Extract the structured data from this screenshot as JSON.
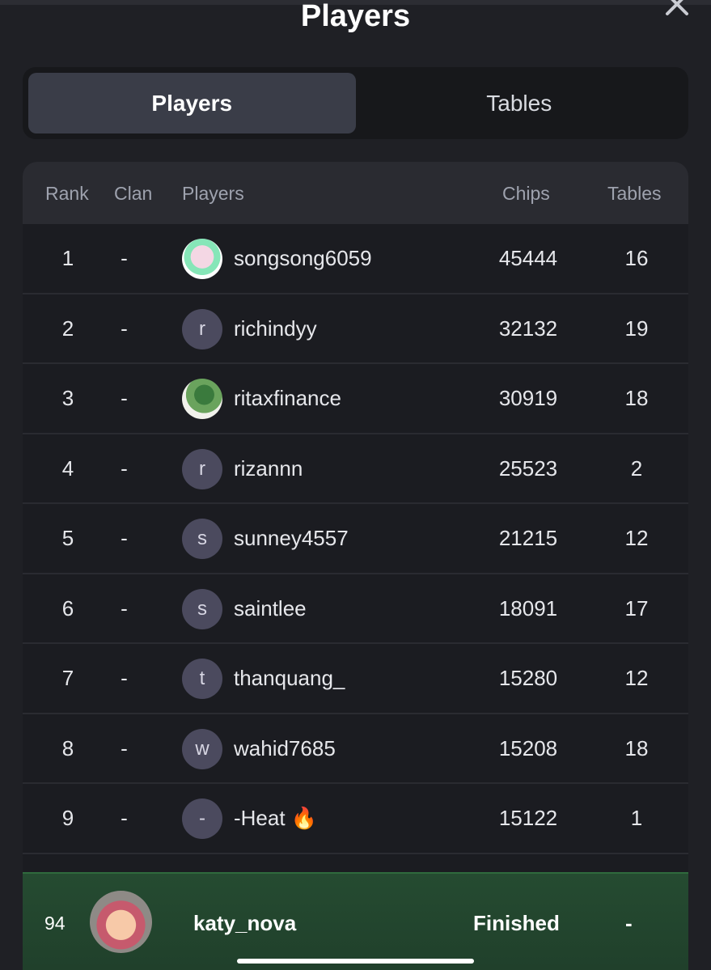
{
  "header": {
    "title": "Players"
  },
  "tabs": [
    {
      "label": "Players",
      "active": true
    },
    {
      "label": "Tables",
      "active": false
    }
  ],
  "table": {
    "columns": {
      "rank": "Rank",
      "clan": "Clan",
      "players": "Players",
      "chips": "Chips",
      "tables": "Tables"
    },
    "rows": [
      {
        "rank": "1",
        "clan": "-",
        "avatar": "",
        "name": "songsong6059",
        "chips": "45444",
        "tables": "16"
      },
      {
        "rank": "2",
        "clan": "-",
        "avatar": "r",
        "name": "richindyy",
        "chips": "32132",
        "tables": "19"
      },
      {
        "rank": "3",
        "clan": "-",
        "avatar": "",
        "name": "ritaxfinance",
        "chips": "30919",
        "tables": "18"
      },
      {
        "rank": "4",
        "clan": "-",
        "avatar": "r",
        "name": "rizannn",
        "chips": "25523",
        "tables": "2"
      },
      {
        "rank": "5",
        "clan": "-",
        "avatar": "s",
        "name": "sunney4557",
        "chips": "21215",
        "tables": "12"
      },
      {
        "rank": "6",
        "clan": "-",
        "avatar": "s",
        "name": "saintlee",
        "chips": "18091",
        "tables": "17"
      },
      {
        "rank": "7",
        "clan": "-",
        "avatar": "t",
        "name": "thanquang_",
        "chips": "15280",
        "tables": "12"
      },
      {
        "rank": "8",
        "clan": "-",
        "avatar": "w",
        "name": "wahid7685",
        "chips": "15208",
        "tables": "18"
      },
      {
        "rank": "9",
        "clan": "-",
        "avatar": "-",
        "name": "-Heat 🔥",
        "chips": "15122",
        "tables": "1"
      }
    ]
  },
  "current_user": {
    "rank": "94",
    "name": "katy_nova",
    "status": "Finished",
    "tables": "-"
  }
}
